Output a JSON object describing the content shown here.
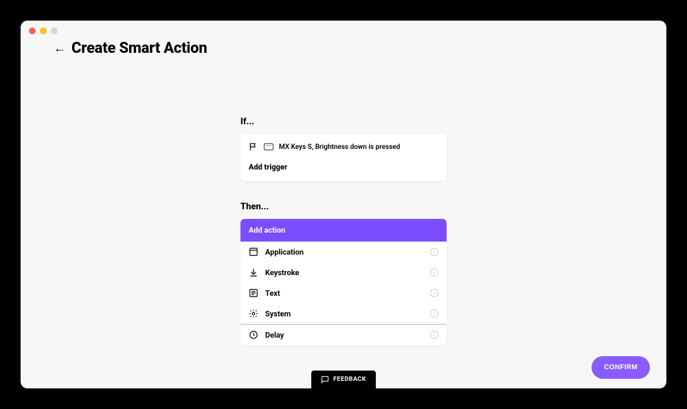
{
  "header": {
    "title": "Create Smart Action"
  },
  "if_section": {
    "label": "If...",
    "trigger_text": "MX Keys S, Brightness down is pressed",
    "add_trigger_label": "Add trigger"
  },
  "then_section": {
    "label": "Then...",
    "add_action_label": "Add action",
    "actions": [
      {
        "label": "Application",
        "icon": "app"
      },
      {
        "label": "Keystroke",
        "icon": "download"
      },
      {
        "label": "Text",
        "icon": "text"
      },
      {
        "label": "System",
        "icon": "gear"
      },
      {
        "label": "Delay",
        "icon": "clock"
      }
    ]
  },
  "buttons": {
    "feedback": "FEEDBACK",
    "confirm": "CONFIRM"
  },
  "colors": {
    "accent": "#7c4dff",
    "confirm": "#8a5cff"
  }
}
